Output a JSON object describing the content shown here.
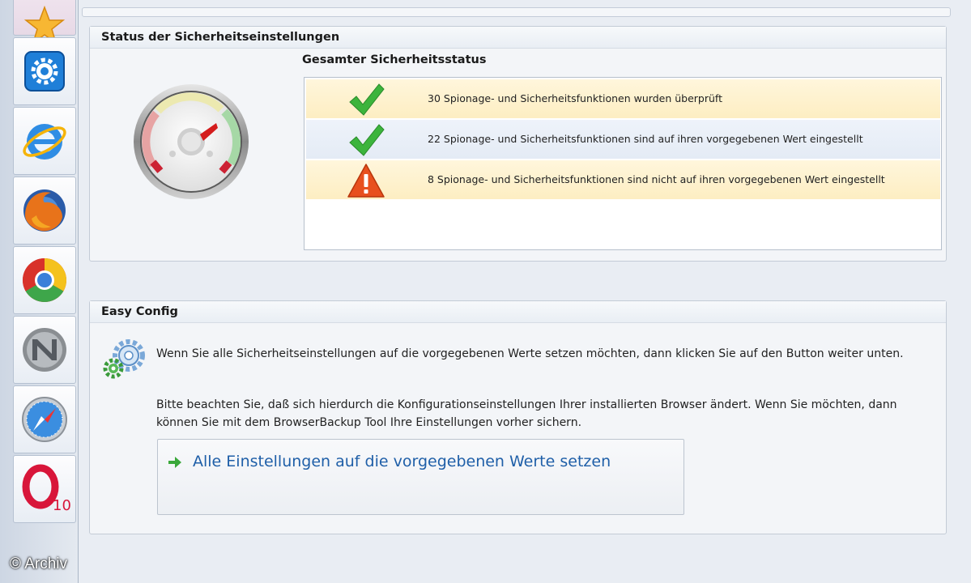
{
  "sidebar": {
    "items": [
      {
        "icon": "star-icon"
      },
      {
        "icon": "settings-gear-icon"
      },
      {
        "icon": "internet-explorer-icon"
      },
      {
        "icon": "firefox-icon"
      },
      {
        "icon": "chrome-icon"
      },
      {
        "icon": "netscape-icon"
      },
      {
        "icon": "safari-icon"
      },
      {
        "icon": "opera-icon",
        "badge": "10"
      }
    ]
  },
  "watermark": "© Archiv",
  "status_panel": {
    "title": "Status der Sicherheitseinstellungen",
    "overall_title": "Gesamter Sicherheitsstatus",
    "rows": [
      {
        "icon": "checkmark-icon",
        "text": "30 Spionage- und Sicherheitsfunktionen wurden überprüft"
      },
      {
        "icon": "checkmark-icon",
        "text": "22 Spionage- und Sicherheitsfunktionen sind auf ihren vorgegebenen Wert eingestellt"
      },
      {
        "icon": "warning-icon",
        "text": "8 Spionage- und Sicherheitsfunktionen sind nicht auf ihren vorgegebenen Wert eingestellt"
      }
    ]
  },
  "easy_config": {
    "title": "Easy Config",
    "para1": "Wenn Sie alle Sicherheitseinstellungen auf die vorgegebenen Werte setzen möchten, dann klicken Sie auf den Button weiter unten.",
    "para2": "Bitte beachten Sie, daß sich hierdurch die Konfigurationseinstellungen Ihrer installierten Browser ändert. Wenn Sie möchten, dann können Sie mit dem BrowserBackup Tool Ihre Einstellungen vorher sichern.",
    "button_label": "Alle Einstellungen auf die vorgegebenen Werte setzen"
  },
  "colors": {
    "link": "#1f5fa8",
    "check": "#3cb43c",
    "warning": "#e8501e"
  }
}
